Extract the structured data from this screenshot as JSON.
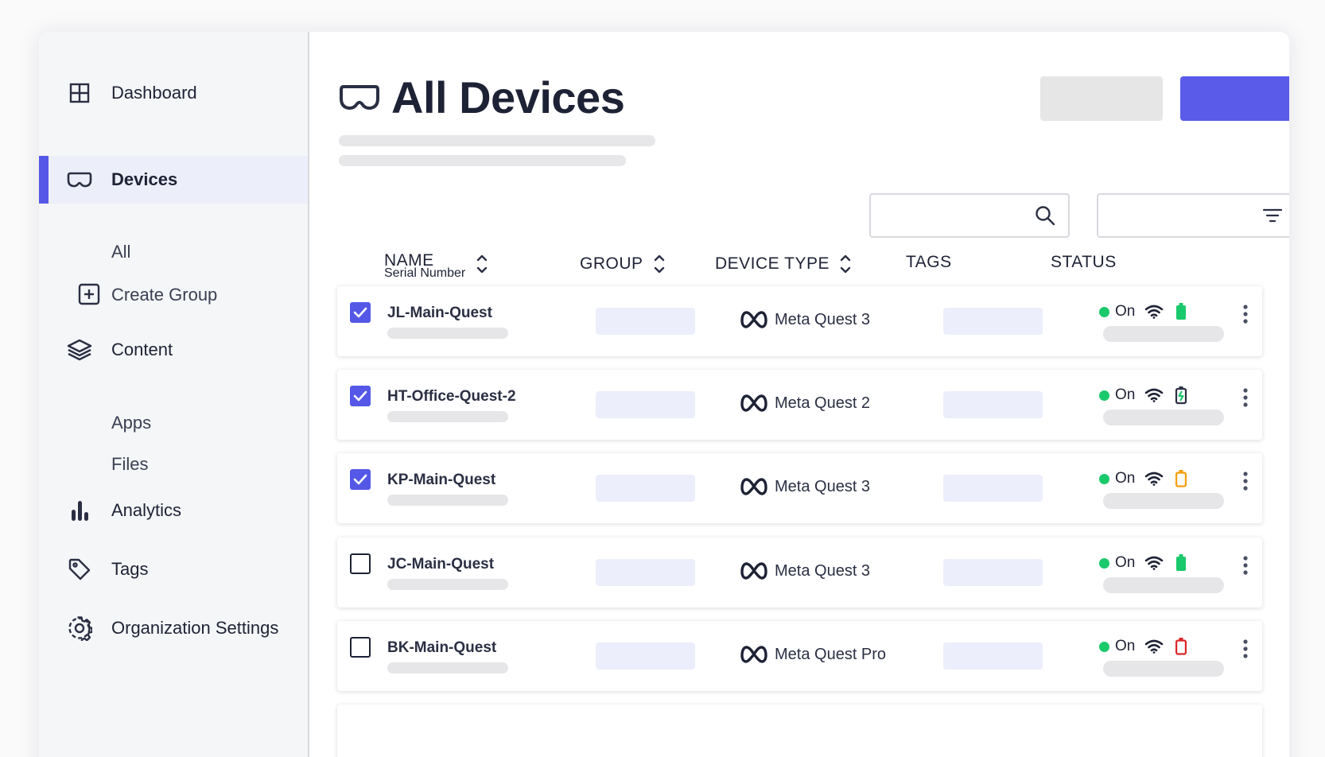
{
  "sidebar": {
    "dashboard": "Dashboard",
    "devices": "Devices",
    "devices_all": "All",
    "create_group": "Create Group",
    "content": "Content",
    "apps": "Apps",
    "files": "Files",
    "analytics": "Analytics",
    "tags": "Tags",
    "org_settings": "Organization Settings"
  },
  "page": {
    "title": "All Devices"
  },
  "colors": {
    "accent": "#5558e6",
    "status_on": "#1ac96b",
    "battery_full": "#1ac96b",
    "battery_mid": "#f59e0b",
    "battery_low": "#dc2626",
    "battery_charging": "#2b2f43"
  },
  "table": {
    "headers": {
      "name": "NAME",
      "serial": "Serial Number",
      "group": "GROUP",
      "device_type": "DEVICE TYPE",
      "tags": "TAGS",
      "status": "STATUS"
    },
    "rows": [
      {
        "name": "JL-Main-Quest",
        "device_type": "Meta Quest 3",
        "status": "On",
        "checked": true,
        "battery": "full"
      },
      {
        "name": "HT-Office-Quest-2",
        "device_type": "Meta Quest 2",
        "status": "On",
        "checked": true,
        "battery": "charging"
      },
      {
        "name": "KP-Main-Quest",
        "device_type": "Meta Quest 3",
        "status": "On",
        "checked": true,
        "battery": "mid"
      },
      {
        "name": "JC-Main-Quest",
        "device_type": "Meta Quest 3",
        "status": "On",
        "checked": false,
        "battery": "full"
      },
      {
        "name": "BK-Main-Quest",
        "device_type": "Meta Quest Pro",
        "status": "On",
        "checked": false,
        "battery": "low"
      }
    ]
  },
  "icons": {
    "dashboard": "grid-icon",
    "devices": "vr-headset-icon",
    "create_group": "plus-square-icon",
    "content": "layers-icon",
    "analytics": "bar-chart-icon",
    "tags": "tag-icon",
    "settings": "gear-icon",
    "search": "search-icon",
    "filter": "filter-icon",
    "sort": "sort-icon",
    "meta": "meta-logo-icon",
    "wifi": "wifi-icon",
    "more": "more-vertical-icon"
  }
}
